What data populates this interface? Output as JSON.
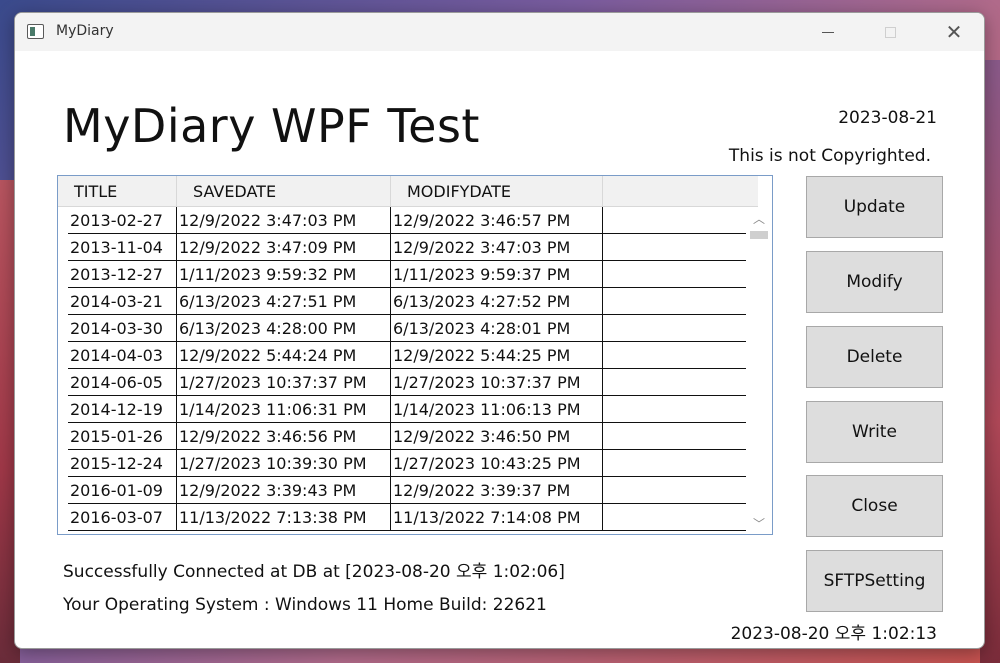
{
  "window": {
    "title": "MyDiary",
    "minimize_glyph": "—",
    "close_glyph": "✕"
  },
  "header": {
    "title": "MyDiary WPF Test",
    "date": "2023-08-21",
    "copyright": "This is not Copyrighted."
  },
  "grid": {
    "columns": [
      "TITLE",
      "SAVEDATE",
      "MODIFYDATE"
    ],
    "rows": [
      {
        "title": "2013-02-27",
        "savedate": "12/9/2022 3:47:03 PM",
        "modifydate": "12/9/2022 3:46:57 PM"
      },
      {
        "title": "2013-11-04",
        "savedate": "12/9/2022 3:47:09 PM",
        "modifydate": "12/9/2022 3:47:03 PM"
      },
      {
        "title": "2013-12-27",
        "savedate": "1/11/2023 9:59:32 PM",
        "modifydate": "1/11/2023 9:59:37 PM"
      },
      {
        "title": "2014-03-21",
        "savedate": "6/13/2023 4:27:51 PM",
        "modifydate": "6/13/2023 4:27:52 PM"
      },
      {
        "title": "2014-03-30",
        "savedate": "6/13/2023 4:28:00 PM",
        "modifydate": "6/13/2023 4:28:01 PM"
      },
      {
        "title": "2014-04-03",
        "savedate": "12/9/2022 5:44:24 PM",
        "modifydate": "12/9/2022 5:44:25 PM"
      },
      {
        "title": "2014-06-05",
        "savedate": "1/27/2023 10:37:37 PM",
        "modifydate": "1/27/2023 10:37:37 PM"
      },
      {
        "title": "2014-12-19",
        "savedate": "1/14/2023 11:06:31 PM",
        "modifydate": "1/14/2023 11:06:13 PM"
      },
      {
        "title": "2015-01-26",
        "savedate": "12/9/2022 3:46:56 PM",
        "modifydate": "12/9/2022 3:46:50 PM"
      },
      {
        "title": "2015-12-24",
        "savedate": "1/27/2023 10:39:30 PM",
        "modifydate": "1/27/2023 10:43:25 PM"
      },
      {
        "title": "2016-01-09",
        "savedate": "12/9/2022 3:39:43 PM",
        "modifydate": "12/9/2022 3:39:37 PM"
      },
      {
        "title": "2016-03-07",
        "savedate": "11/13/2022 7:13:38 PM",
        "modifydate": "11/13/2022 7:14:08 PM"
      }
    ]
  },
  "buttons": {
    "update": "Update",
    "modify": "Modify",
    "delete": "Delete",
    "write": "Write",
    "close": "Close",
    "sftp": "SFTPSetting"
  },
  "status": {
    "connection": "Successfully Connected at DB at [2023-08-20 오후 1:02:06]",
    "os": "Your Operating System : Windows 11 Home Build: 22621",
    "clock": "2023-08-20 오후 1:02:13"
  },
  "colors": {
    "accent_border": "#7a9cc8",
    "button_bg": "#dddddd"
  }
}
